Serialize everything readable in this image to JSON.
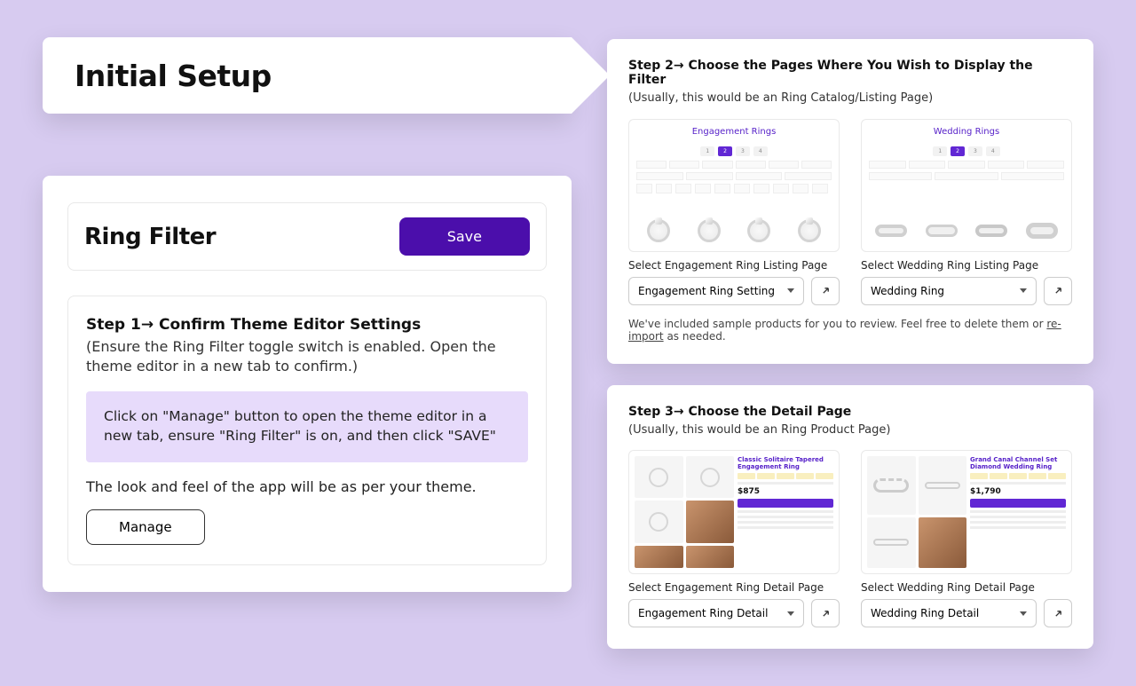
{
  "page_title": "Initial Setup",
  "step1": {
    "header": "Ring Filter",
    "save_label": "Save",
    "title": "Step 1→  Confirm Theme Editor Settings",
    "sub": "(Ensure the Ring Filter toggle switch is enabled. Open the theme editor in a new tab to confirm.)",
    "hint": "Click on \"Manage\" button to open the theme editor in a new tab, ensure \"Ring Filter\" is on, and then click \"SAVE\"",
    "look": "The look and feel of the app will be as per your theme.",
    "manage_label": "Manage"
  },
  "step2": {
    "title": "Step 2→ Choose the Pages Where You Wish to Display the Filter",
    "sub": "(Usually, this would be an Ring Catalog/Listing Page)",
    "left_preview_title": "Engagement Rings",
    "right_preview_title": "Wedding Rings",
    "left_label": "Select Engagement Ring Listing Page",
    "right_label": "Select Wedding Ring Listing Page",
    "left_value": "Engagement Ring Setting",
    "right_value": "Wedding Ring",
    "note_prefix": "We've included sample products for you to review. Feel free to delete them or ",
    "note_link": "re-import",
    "note_suffix": " as needed."
  },
  "step3": {
    "title": "Step 3→ Choose the Detail Page",
    "sub": "(Usually, this would be an Ring Product Page)",
    "left_product": "Classic Solitaire Tapered Engagement Ring",
    "left_price": "$875",
    "right_product": "Grand Canal Channel Set Diamond Wedding Ring",
    "right_price": "$1,790",
    "left_label": "Select Engagement Ring Detail Page",
    "right_label": "Select Wedding Ring Detail Page",
    "left_value": "Engagement Ring Detail",
    "right_value": "Wedding Ring Detail"
  }
}
